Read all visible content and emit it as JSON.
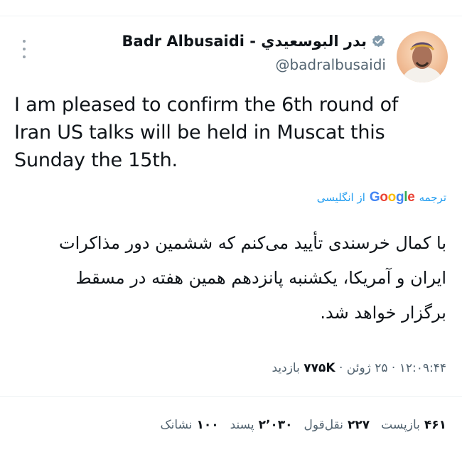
{
  "author": {
    "name": "Badr Albusaidi - بدر البوسعيدي",
    "handle": "@badralbusaidi",
    "verified_icon": "verified-badge-icon"
  },
  "tweet": {
    "text": "I am pleased to confirm the 6th round of Iran US talks will be held in Muscat this Sunday the 15th."
  },
  "translation": {
    "label_prefix": "ترجمه",
    "provider": "Google",
    "label_suffix": "از انگلیسی",
    "text": "با کمال خرسندی تأیید می‌کنم که ششمین دور مذاکرات ایران و آمریکا، یکشنبه پانزدهم همین هفته در مسقط برگزار خواهد شد."
  },
  "meta": {
    "time": "۱۲:۰۹:۴۴",
    "date": "۲۵ ژوئن",
    "views_count": "۷۷۵K",
    "views_label": "بازدید"
  },
  "stats": [
    {
      "count": "۴۶۱",
      "label": "بازپست"
    },
    {
      "count": "۲۲۷",
      "label": "نقل‌قول"
    },
    {
      "count": "۲٬۰۳۰",
      "label": "پسند"
    },
    {
      "count": "۱۰۰",
      "label": "نشانک"
    }
  ],
  "colors": {
    "accent": "#1d9bf0",
    "text": "#0f1419",
    "muted": "#536471"
  }
}
